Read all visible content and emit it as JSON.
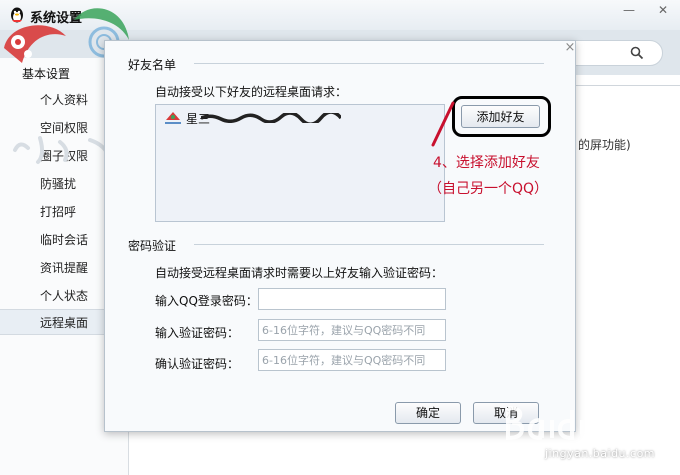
{
  "window": {
    "title": "系统设置",
    "minimize_glyph": "—",
    "close_glyph": "✕"
  },
  "sidebar": {
    "heading": "基本设置",
    "items": [
      {
        "label": "个人资料"
      },
      {
        "label": "空间权限"
      },
      {
        "label": "圈子权限"
      },
      {
        "label": "防骚扰"
      },
      {
        "label": "打招呼"
      },
      {
        "label": "临时会话"
      },
      {
        "label": "资讯提醒"
      },
      {
        "label": "个人状态"
      },
      {
        "label": "远程桌面"
      }
    ],
    "active_item": "远程桌面"
  },
  "background": {
    "partial_text": "的屏功能)"
  },
  "dialog": {
    "close_glyph": "×",
    "friends_section": {
      "title": "好友名单",
      "description": "自动接受以下好友的远程桌面请求：",
      "friends": [
        {
          "name": "星三"
        }
      ],
      "add_button": "添加好友"
    },
    "password_section": {
      "title": "密码验证",
      "description": "自动接受远程桌面请求时需要以上好友输入验证密码：",
      "fields": [
        {
          "label": "输入QQ登录密码：",
          "value": "",
          "placeholder": ""
        },
        {
          "label": "输入验证密码：",
          "value": "",
          "placeholder": "6-16位字符，建议与QQ密码不同"
        },
        {
          "label": "确认验证密码：",
          "value": "",
          "placeholder": "6-16位字符，建议与QQ密码不同"
        }
      ]
    },
    "ok_button": "确定",
    "cancel_button": "取消"
  },
  "annotation": {
    "line1": "4、选择添加好友",
    "line2": "（自己另一个QQ）",
    "color": "#c8102e"
  },
  "watermark": {
    "url": "jingyan.baidu.com"
  }
}
